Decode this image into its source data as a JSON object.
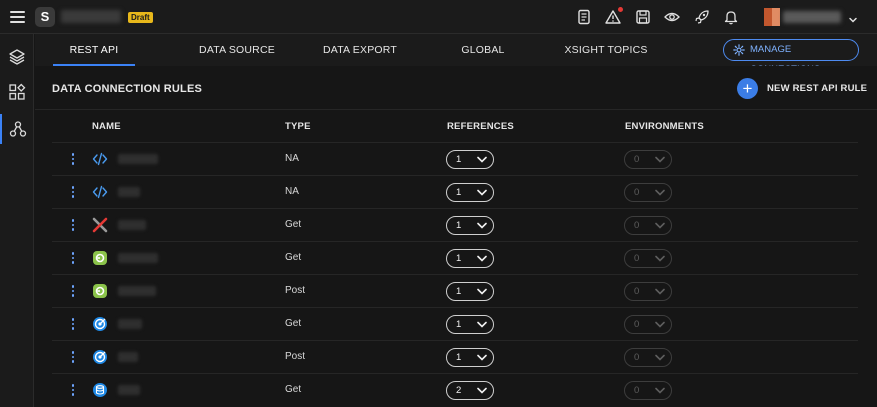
{
  "header": {
    "logo_letter": "S",
    "app_name": "",
    "draft_badge": "Draft",
    "user_name": "",
    "icons": [
      "document-icon",
      "alert-icon",
      "save-icon",
      "eye-icon",
      "rocket-icon",
      "bell-icon"
    ]
  },
  "sidebar": {
    "items": [
      {
        "icon": "layers-icon",
        "active": false
      },
      {
        "icon": "widgets-icon",
        "active": false
      },
      {
        "icon": "connections-icon",
        "active": true
      }
    ]
  },
  "tabs": [
    {
      "label": "REST API",
      "active": true
    },
    {
      "label": "DATA SOURCE",
      "active": false
    },
    {
      "label": "DATA EXPORT",
      "active": false
    },
    {
      "label": "GLOBAL VARIABLES",
      "active": false
    },
    {
      "label": "XSIGHT TOPICS",
      "active": false
    }
  ],
  "manage_connections_label": "MANAGE CONNECTIONS",
  "page": {
    "title": "DATA CONNECTION RULES",
    "new_rule_label": "NEW REST API RULE"
  },
  "table": {
    "columns": {
      "name": "NAME",
      "type": "TYPE",
      "references": "REFERENCES",
      "environments": "ENVIRONMENTS"
    },
    "rows": [
      {
        "icon": "code-icon",
        "name": "",
        "type": "NA",
        "references": "1",
        "environments": "0"
      },
      {
        "icon": "code-icon",
        "name": "",
        "type": "NA",
        "references": "1",
        "environments": "0"
      },
      {
        "icon": "x-logo-icon",
        "name": "",
        "type": "Get",
        "references": "1",
        "environments": "0"
      },
      {
        "icon": "green-app-icon",
        "name": "",
        "type": "Get",
        "references": "1",
        "environments": "0"
      },
      {
        "icon": "green-app-icon",
        "name": "",
        "type": "Post",
        "references": "1",
        "environments": "0"
      },
      {
        "icon": "target-icon",
        "name": "",
        "type": "Get",
        "references": "1",
        "environments": "0"
      },
      {
        "icon": "target-icon",
        "name": "",
        "type": "Post",
        "references": "1",
        "environments": "0"
      },
      {
        "icon": "database-icon",
        "name": "",
        "type": "Get",
        "references": "2",
        "environments": "0"
      }
    ]
  },
  "colors": {
    "accent": "#3b82f6",
    "background": "#161616",
    "panel": "#1b1b1b",
    "draft": "#e8b81b"
  }
}
